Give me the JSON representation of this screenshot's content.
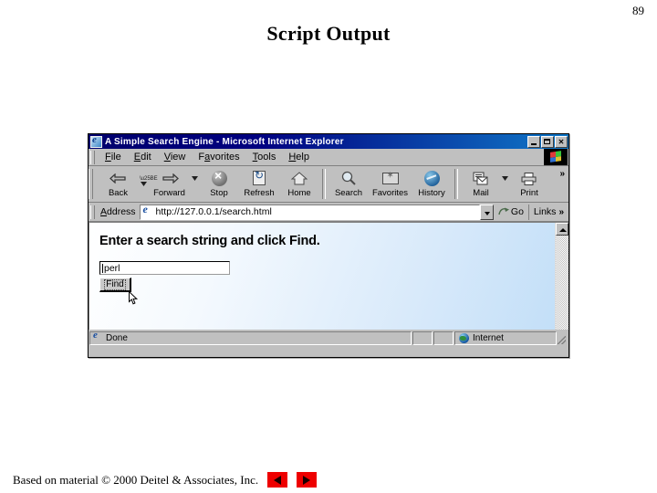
{
  "slide": {
    "page_number": "89",
    "title": "Script Output",
    "footer_text": "Based on material © 2000 Deitel & Associates, Inc.",
    "prev_button_label": "previous-slide",
    "next_button_label": "next-slide"
  },
  "browser": {
    "titlebar": {
      "text": "A Simple Search Engine - Microsoft Internet Explorer",
      "app_icon": "internet-explorer-icon",
      "minimize_label": "",
      "maximize_label": "",
      "close_label": "✕"
    },
    "menu": {
      "items": [
        {
          "pre": "",
          "key": "F",
          "post": "ile"
        },
        {
          "pre": "",
          "key": "E",
          "post": "dit"
        },
        {
          "pre": "",
          "key": "V",
          "post": "iew"
        },
        {
          "pre": "F",
          "key": "a",
          "post": "vorites"
        },
        {
          "pre": "",
          "key": "T",
          "post": "ools"
        },
        {
          "pre": "",
          "key": "H",
          "post": "elp"
        }
      ],
      "logo": "windows-flag-logo"
    },
    "toolbar": {
      "buttons": [
        {
          "label": "Back",
          "icon": "back-arrow-icon",
          "has_dropdown": true
        },
        {
          "label": "Forward",
          "icon": "forward-arrow-icon",
          "has_dropdown": true
        },
        {
          "label": "Stop",
          "icon": "stop-icon",
          "has_dropdown": false
        },
        {
          "label": "Refresh",
          "icon": "refresh-icon",
          "has_dropdown": false
        },
        {
          "label": "Home",
          "icon": "home-icon",
          "has_dropdown": false
        },
        {
          "label": "Search",
          "icon": "search-icon",
          "has_dropdown": false
        },
        {
          "label": "Favorites",
          "icon": "favorites-folder-icon",
          "has_dropdown": false
        },
        {
          "label": "History",
          "icon": "history-icon",
          "has_dropdown": false
        },
        {
          "label": "Mail",
          "icon": "mail-icon",
          "has_dropdown": true
        },
        {
          "label": "Print",
          "icon": "printer-icon",
          "has_dropdown": false
        }
      ],
      "overflow_chevron": "»"
    },
    "address": {
      "label": "Address",
      "url": "http://127.0.0.1/search.html",
      "go_label": "Go",
      "links_label": "Links",
      "links_chevron": "»"
    },
    "page": {
      "heading": "Enter a search string and click Find.",
      "search_value": "perl",
      "search_placeholder": "",
      "find_label": "Find"
    },
    "status": {
      "left_text": "Done",
      "zone_text": "Internet",
      "zone_icon": "globe-icon"
    }
  },
  "colors": {
    "titlebar_start": "#000080",
    "titlebar_end": "#1078c8",
    "chrome_face": "#c0c0c0",
    "page_gradient_start": "#ffffff",
    "page_gradient_end": "#c3dff8",
    "nav_button_red": "#ee0000"
  }
}
